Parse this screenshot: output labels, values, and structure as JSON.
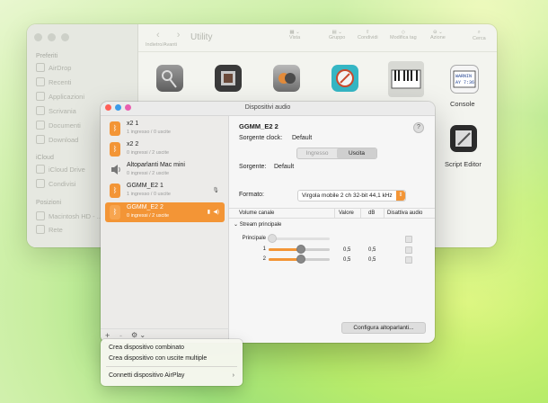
{
  "finder": {
    "title": "Utility",
    "nav_label": "Indietro/Avanti",
    "toolbar": [
      "Vista",
      "Gruppo",
      "Condividi",
      "Modifica tag",
      "Azione",
      "Cerca"
    ],
    "sidebar": {
      "sections": [
        "Preferiti",
        "iCloud",
        "Posizioni"
      ],
      "favorites": [
        "AirDrop",
        "Recenti",
        "Applicazioni",
        "Scrivania",
        "Documenti",
        "Download"
      ],
      "icloud": [
        "iCloud Drive",
        "Condivisi"
      ],
      "locations": [
        "Macintosh HD - ...",
        "Rete"
      ]
    },
    "apps": [
      {
        "label": "",
        "icon": "keychain-icon"
      },
      {
        "label": "",
        "icon": "bootcamp-icon"
      },
      {
        "label": "",
        "icon": "migration-icon"
      },
      {
        "label": "",
        "icon": "network-utility-icon"
      },
      {
        "label": "",
        "icon": "midi-icon"
      },
      {
        "label": "Console",
        "icon": "console-icon"
      },
      {
        "label": "Script Editor",
        "icon": "script-editor-icon"
      }
    ],
    "console_icon_text": "WARNIN\nAY 7:36"
  },
  "audio_window": {
    "title": "Dispositivi audio",
    "devices": [
      {
        "name": "x2 1",
        "sub": "1 ingresso / 0 uscite",
        "icon": "bluetooth-icon"
      },
      {
        "name": "x2 2",
        "sub": "0 ingressi / 2 uscite",
        "icon": "bluetooth-icon"
      },
      {
        "name": "Altoparlanti Mac mini",
        "sub": "0 ingressi / 2 uscite",
        "icon": "speaker-icon"
      },
      {
        "name": "GGMM_E2 1",
        "sub": "1 ingresso / 0 uscite",
        "icon": "bluetooth-icon"
      },
      {
        "name": "GGMM_E2 2",
        "sub": "0 ingressi / 2 uscite",
        "icon": "bluetooth-icon"
      }
    ],
    "selected_index": 4,
    "bottom_buttons": [
      "+",
      "-",
      "⚙ ⌄"
    ],
    "detail": {
      "device_name": "GGMM_E2 2",
      "help": "?",
      "clock_label": "Sorgente clock:",
      "clock_value": "Default",
      "tabs": [
        "Ingresso",
        "Uscita"
      ],
      "active_tab": "Uscita",
      "source_label": "Sorgente:",
      "source_value": "Default",
      "format_label": "Formato:",
      "format_value": "Virgola mobile 2 ch 32-bit 44,1 kHz",
      "columns": [
        "Volume canale",
        "Valore",
        "dB",
        "Disattiva audio"
      ],
      "stream_label": "Stream principale",
      "channels": [
        {
          "label": "Principale",
          "value": "",
          "db": "",
          "level": 0
        },
        {
          "label": "1",
          "value": "0,5",
          "db": "0,5",
          "level": 0.5
        },
        {
          "label": "2",
          "value": "0,5",
          "db": "0,5",
          "level": 0.5
        }
      ],
      "config_button": "Configura altoparlanti..."
    }
  },
  "menu": {
    "items": [
      "Crea dispositivo combinato",
      "Crea dispositivo con uscite multiple",
      "Connetti dispositivo AirPlay"
    ],
    "submenu_arrow": "›"
  }
}
